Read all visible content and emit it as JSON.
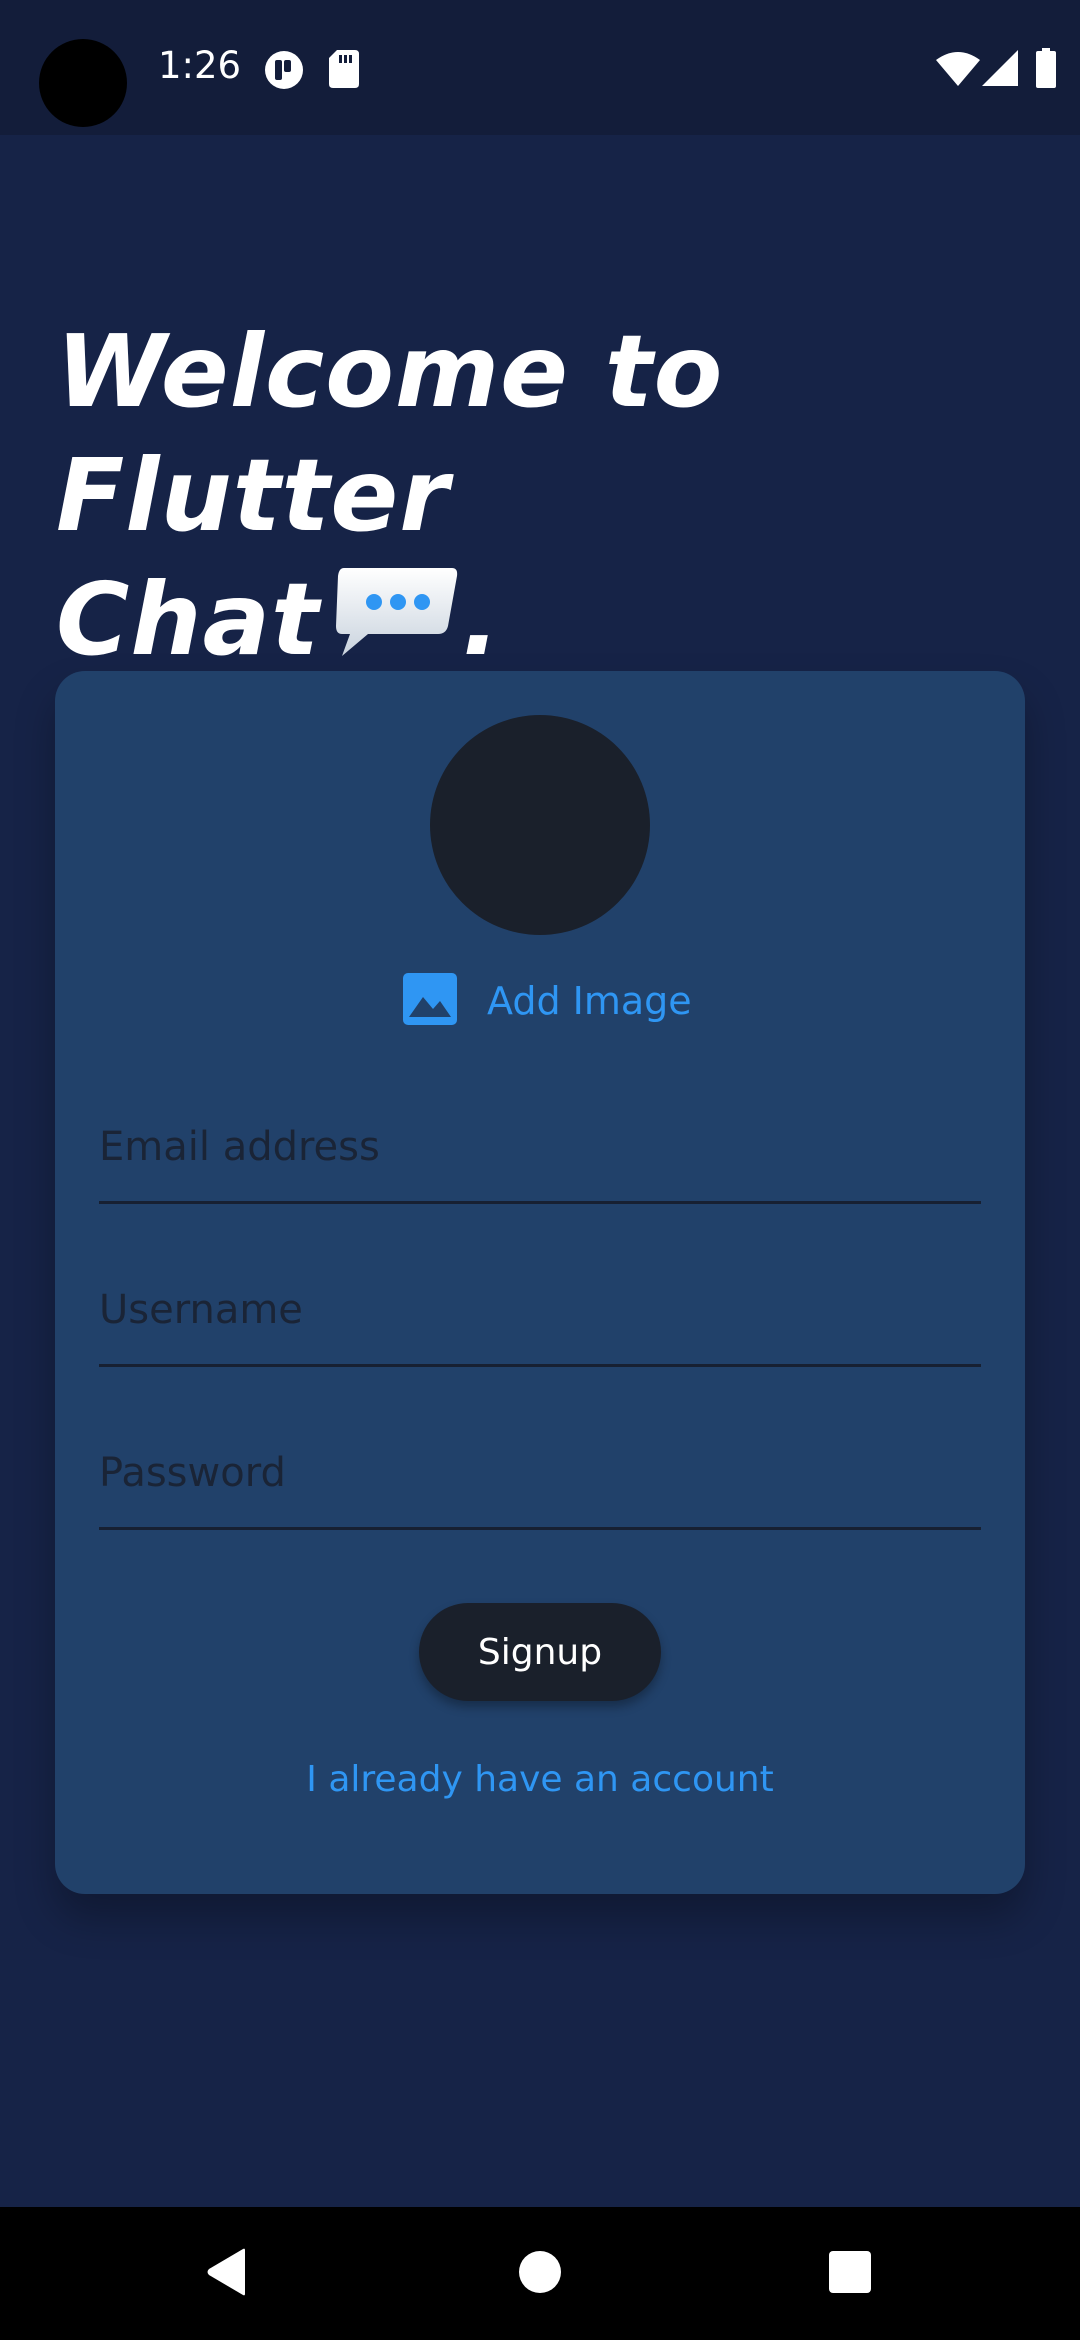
{
  "status_bar": {
    "time": "1:26",
    "icons": [
      "notification-icon",
      "sd-card-icon",
      "wifi-icon",
      "signal-icon",
      "battery-icon"
    ]
  },
  "title": {
    "line1": "Welcome to Flutter",
    "line2_text": "Chat",
    "line2_suffix": ".",
    "emoji_icon": "speech-bubble-icon"
  },
  "form": {
    "add_image_label": "Add Image",
    "add_image_icon": "image-icon",
    "email_placeholder": "Email address",
    "username_placeholder": "Username",
    "password_placeholder": "Password",
    "signup_label": "Signup",
    "login_link": "I already have an account"
  },
  "navigation": {
    "back": "back-icon",
    "home": "home-icon",
    "recents": "recents-icon"
  },
  "colors": {
    "background": "#162347",
    "card": "#21416a",
    "accent": "#2f96f3",
    "dark": "#1a202b"
  }
}
